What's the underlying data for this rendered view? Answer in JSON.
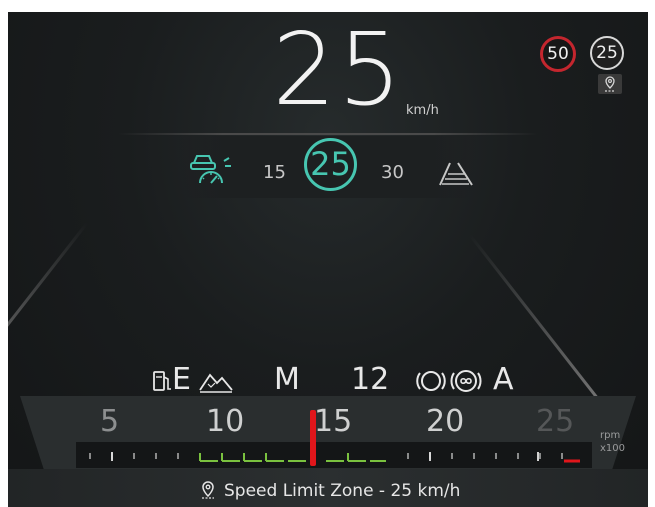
{
  "speed": {
    "value": "25",
    "unit": "km/h"
  },
  "signs": {
    "speed_limit": "50",
    "zone_limit": "25"
  },
  "acc": {
    "lower": "15",
    "set": "25",
    "upper": "30"
  },
  "status": {
    "energy": "E",
    "mode": "M",
    "value": "12",
    "auto": "A"
  },
  "tacho": {
    "marks": [
      "5",
      "10",
      "15",
      "20",
      "25"
    ],
    "unit": "rpm",
    "unit_multiplier": "x100"
  },
  "zone_banner": {
    "text": "Speed Limit Zone - 25 km/h"
  },
  "colors": {
    "accent": "#47c6b1",
    "limit_ring": "#c4262e",
    "needle": "#e0161b",
    "eco": "#7ac13f"
  }
}
